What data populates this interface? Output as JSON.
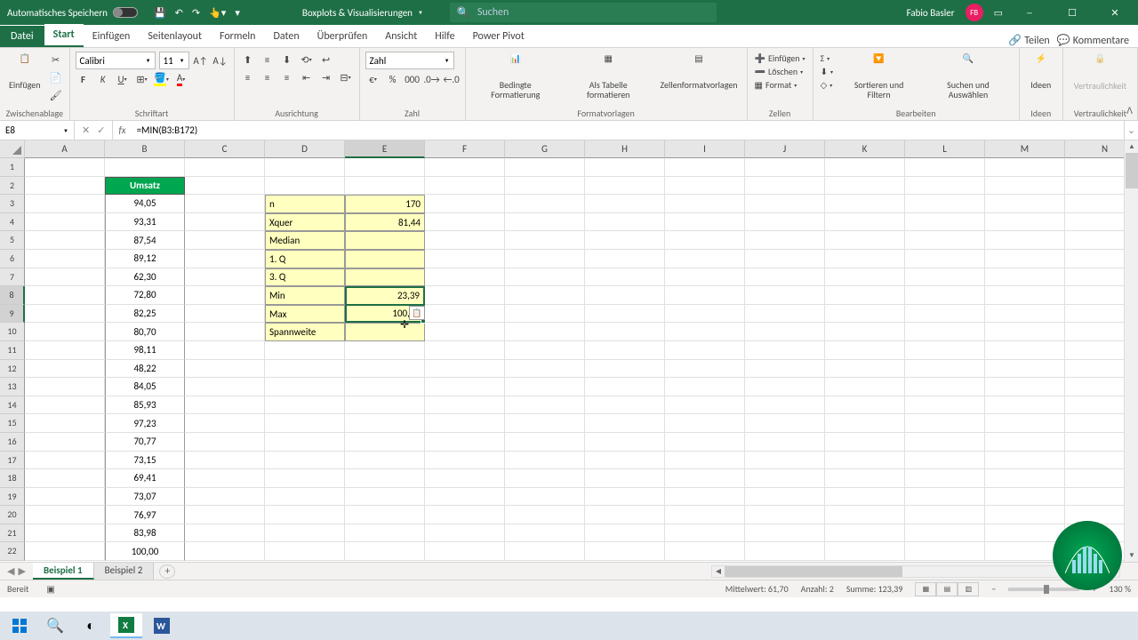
{
  "titlebar": {
    "autosave": "Automatisches Speichern",
    "doc_title": "Boxplots & Visualisierungen",
    "search_placeholder": "Suchen",
    "user_name": "Fabio Basler",
    "user_initials": "FB"
  },
  "tabs": {
    "file": "Datei",
    "home": "Start",
    "insert": "Einfügen",
    "layout": "Seitenlayout",
    "formulas": "Formeln",
    "data": "Daten",
    "review": "Überprüfen",
    "view": "Ansicht",
    "help": "Hilfe",
    "powerpivot": "Power Pivot",
    "share": "Teilen",
    "comments": "Kommentare"
  },
  "ribbon": {
    "clipboard": {
      "label": "Zwischenablage",
      "paste": "Einfügen"
    },
    "font": {
      "label": "Schriftart",
      "name": "Calibri",
      "size": "11"
    },
    "align": {
      "label": "Ausrichtung"
    },
    "number": {
      "label": "Zahl",
      "format": "Zahl"
    },
    "styles": {
      "label": "Formatvorlagen",
      "cond": "Bedingte Formatierung",
      "table": "Als Tabelle formatieren",
      "cell": "Zellenformatvorlagen"
    },
    "cells": {
      "label": "Zellen",
      "insert": "Einfügen",
      "delete": "Löschen",
      "format": "Format"
    },
    "editing": {
      "label": "Bearbeiten",
      "sort": "Sortieren und Filtern",
      "find": "Suchen und Auswählen"
    },
    "ideas": {
      "label": "Ideen",
      "btn": "Ideen"
    },
    "sens": {
      "label": "Vertraulichkeit",
      "btn": "Vertraulichkeit"
    }
  },
  "formula_bar": {
    "name_box": "E8",
    "formula": "=MIN(B3:B172)"
  },
  "columns": [
    "A",
    "B",
    "C",
    "D",
    "E",
    "F",
    "G",
    "H",
    "I",
    "J",
    "K",
    "L",
    "M",
    "N"
  ],
  "rows": [
    "1",
    "2",
    "3",
    "4",
    "5",
    "6",
    "7",
    "8",
    "9",
    "10",
    "11",
    "12",
    "13",
    "14",
    "15",
    "16",
    "17",
    "18",
    "19",
    "20",
    "21",
    "22"
  ],
  "umsatz": {
    "header": "Umsatz",
    "values": [
      "94,05",
      "93,31",
      "87,54",
      "89,12",
      "62,30",
      "72,80",
      "82,25",
      "80,70",
      "98,11",
      "48,22",
      "84,05",
      "85,93",
      "97,23",
      "70,77",
      "73,15",
      "69,41",
      "73,07",
      "76,97",
      "83,98",
      "100,00"
    ]
  },
  "stats": {
    "labels": [
      "n",
      "Xquer",
      "Median",
      "1. Q",
      "3. Q",
      "Min",
      "Max",
      "Spannweite"
    ],
    "values": [
      "170",
      "81,44",
      "",
      "",
      "",
      "23,39",
      "100,00",
      ""
    ]
  },
  "sheets": {
    "s1": "Beispiel 1",
    "s2": "Beispiel 2"
  },
  "status": {
    "ready": "Bereit",
    "avg": "Mittelwert: 61,70",
    "count": "Anzahl: 2",
    "sum": "Summe: 123,39",
    "zoom": "130 %"
  }
}
